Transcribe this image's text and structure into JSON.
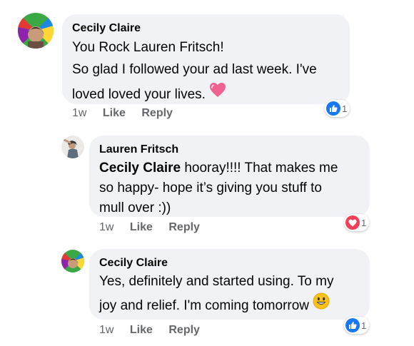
{
  "comments": [
    {
      "author": "Cecily Claire",
      "lines": [
        "You Rock Lauren Fritsch!",
        "So glad I followed your ad last week. I've",
        "loved loved your lives."
      ],
      "emoji": "pink-heart-icon",
      "time": "1w",
      "like_label": "Like",
      "reply_label": "Reply",
      "reaction": {
        "type": "like",
        "count": "1"
      }
    },
    {
      "author": "Lauren Fritsch",
      "mention": "Cecily Claire",
      "lines": [
        " hooray!!!! That makes me",
        "so happy- hope it’s giving you stuff to",
        "mull over :))"
      ],
      "time": "1w",
      "like_label": "Like",
      "reply_label": "Reply",
      "reaction": {
        "type": "love",
        "count": "1"
      }
    },
    {
      "author": "Cecily Claire",
      "lines": [
        "Yes, definitely and started using. To my",
        "joy and relief. I'm coming tomorrow"
      ],
      "emoji": "smiley-face-icon",
      "time": "1w",
      "like_label": "Like",
      "reply_label": "Reply",
      "reaction": {
        "type": "like",
        "count": "1"
      }
    }
  ],
  "colors": {
    "bubble": "#f0f2f5",
    "like_blue": "#1877f2",
    "love_red": "#f33e58",
    "meta_gray": "#65676b"
  }
}
